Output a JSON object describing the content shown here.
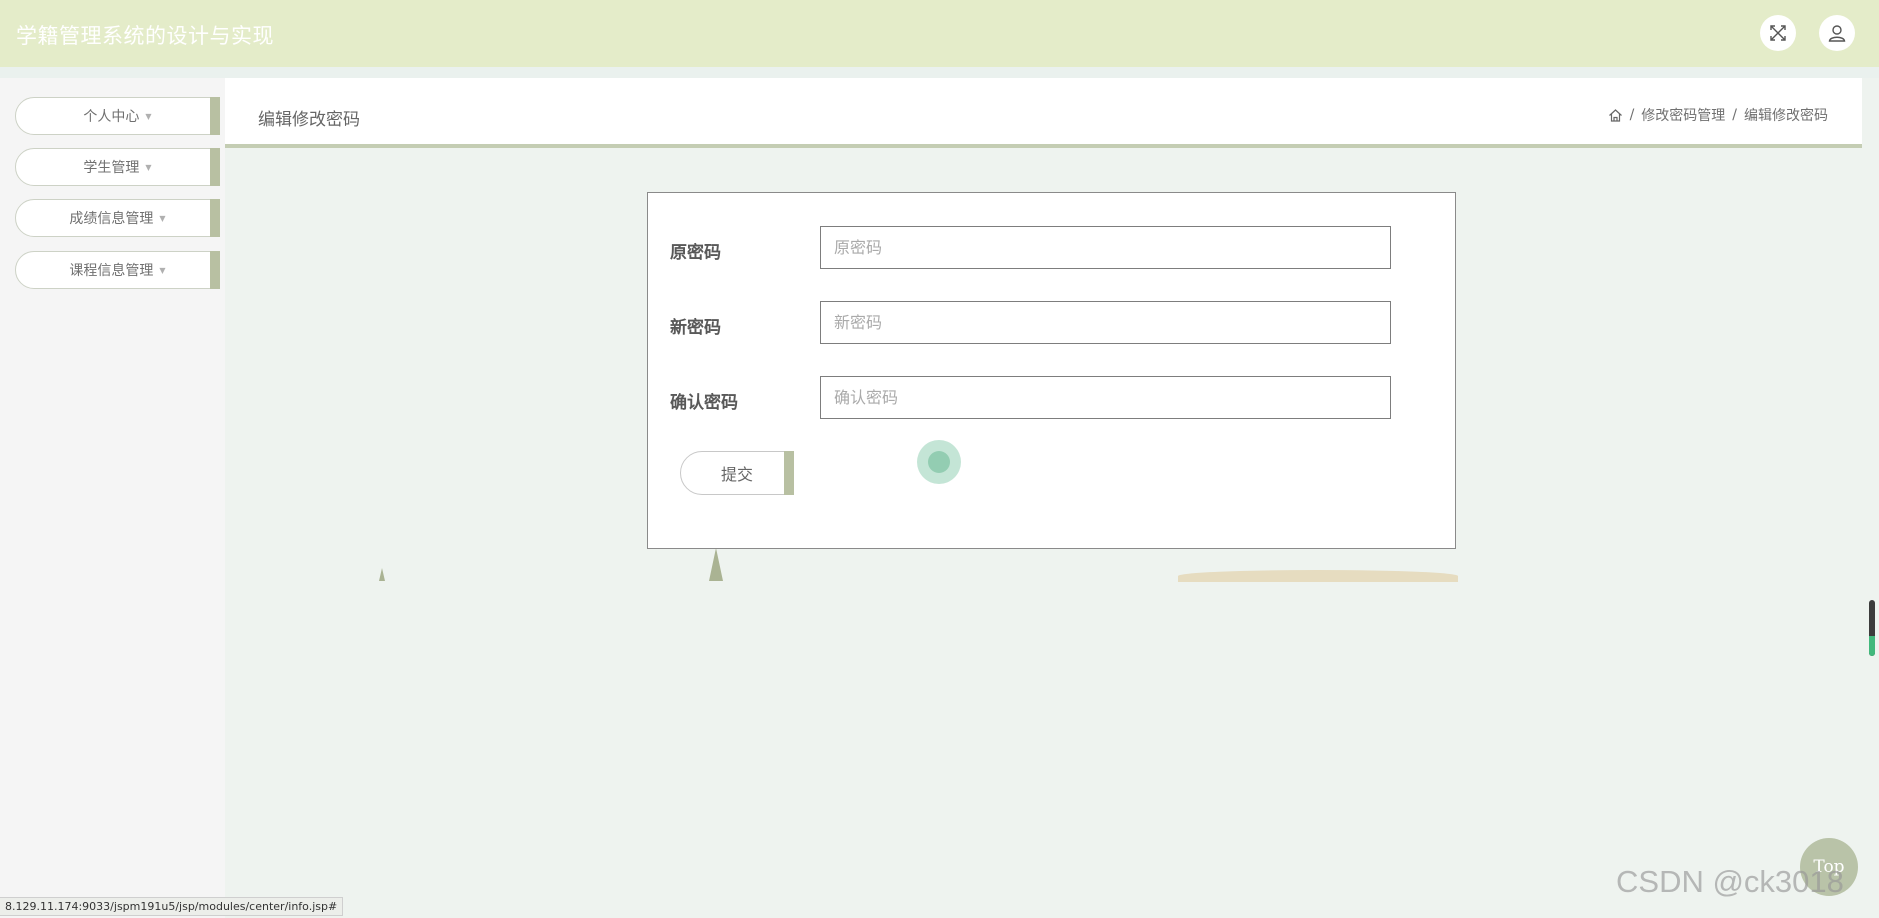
{
  "header": {
    "title": "学籍管理系统的设计与实现",
    "fullscreen_icon": "expand-arrows-icon",
    "user_icon": "user-icon"
  },
  "sidebar": {
    "items": [
      {
        "label": "个人中心"
      },
      {
        "label": "学生管理"
      },
      {
        "label": "成绩信息管理"
      },
      {
        "label": "课程信息管理"
      }
    ]
  },
  "main": {
    "title": "编辑修改密码",
    "breadcrumb": [
      "修改密码管理",
      "编辑修改密码"
    ],
    "breadcrumb_separator": "/"
  },
  "form": {
    "old_password": {
      "label": "原密码",
      "placeholder": "原密码"
    },
    "new_password": {
      "label": "新密码",
      "placeholder": "新密码"
    },
    "confirm_password": {
      "label": "确认密码",
      "placeholder": "确认密码"
    },
    "submit_label": "提交"
  },
  "top_button": "Top",
  "watermark": "CSDN @ck3018",
  "status_url": "8.129.11.174:9033/jspm191u5/jsp/modules/center/info.jsp#",
  "colors": {
    "header_bg": "#e4ecc9",
    "accent_bar": "#b8c0a2",
    "page_bg": "#eef3ef"
  }
}
